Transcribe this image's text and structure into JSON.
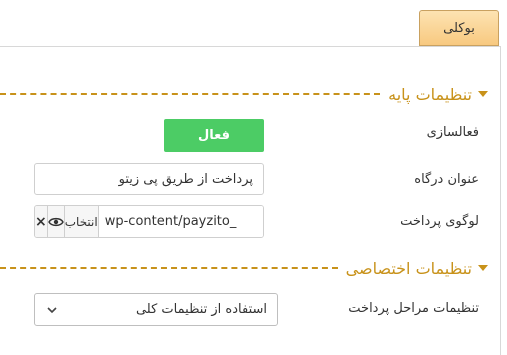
{
  "tabs": {
    "active_label": "بوکلی"
  },
  "sections": {
    "basic": {
      "title": "تنظیمات پایه"
    },
    "custom": {
      "title": "تنظیمات اختصاصی"
    }
  },
  "fields": {
    "activation": {
      "label": "فعالسازی",
      "button_label": "فعال"
    },
    "gateway_title": {
      "label": "عنوان درگاه",
      "value": "پرداخت از طریق پی زیتو"
    },
    "logo": {
      "label": "لوگوی پرداخت",
      "value": "wp-content/payzito_",
      "choose_label": "انتخاب",
      "remove_label": "×"
    },
    "payment_steps": {
      "label": "تنظیمات مراحل پرداخت",
      "selected": "استفاده از تنظیمات کلی"
    }
  },
  "colors": {
    "accent": "#c8921a",
    "active_green": "#4ccc65",
    "tab_bg": "#fbd594"
  }
}
